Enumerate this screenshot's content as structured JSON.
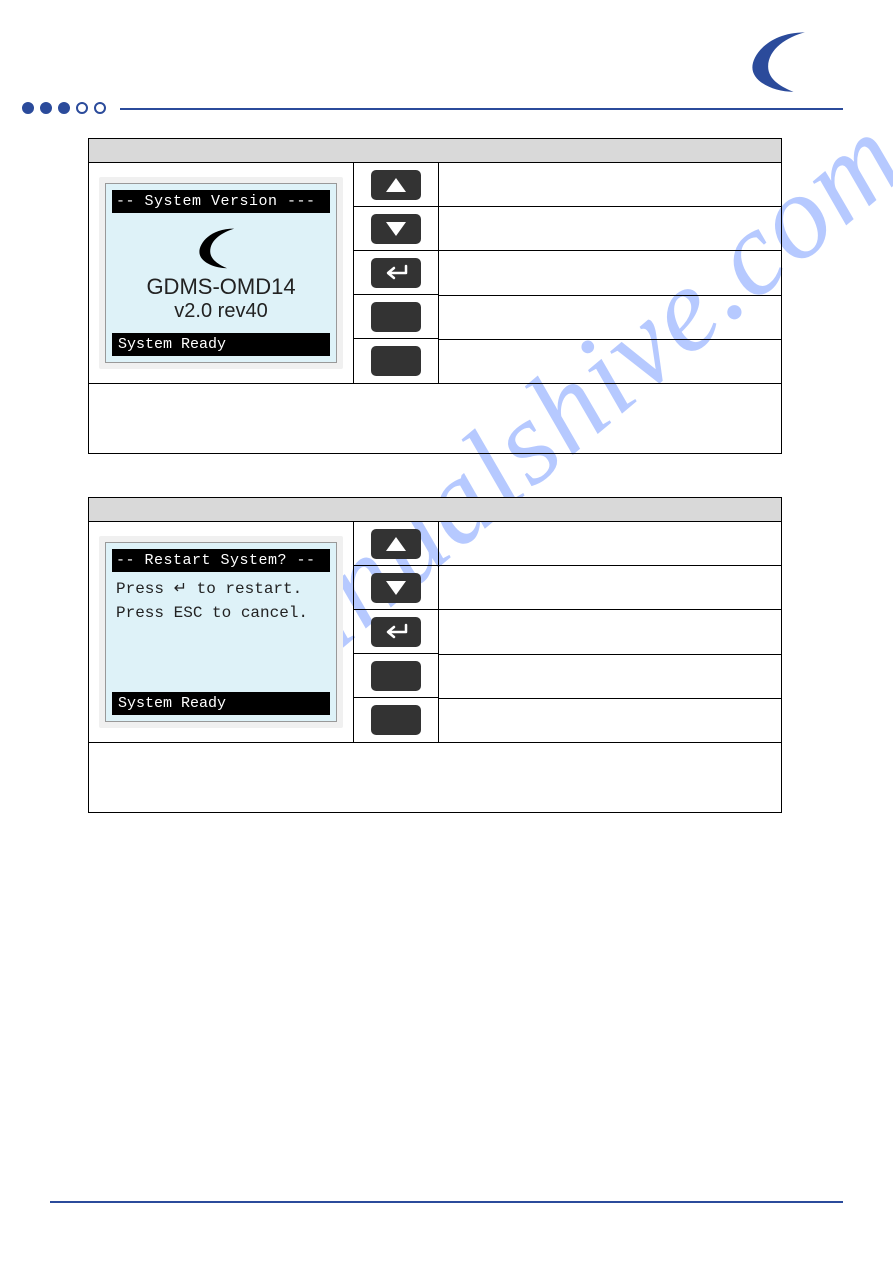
{
  "watermark": "manualshive.com",
  "lcd1": {
    "title": "-- System Version ---",
    "line1": "GDMS-OMD14",
    "line2": "v2.0 rev40",
    "status": "System Ready"
  },
  "lcd2": {
    "title": "-- Restart System? --",
    "line1": "Press ↵  to restart.",
    "line2": "Press ESC to cancel.",
    "status": "System Ready"
  },
  "buttons": {
    "up": "▲",
    "down": "▼",
    "enter": "↵"
  }
}
